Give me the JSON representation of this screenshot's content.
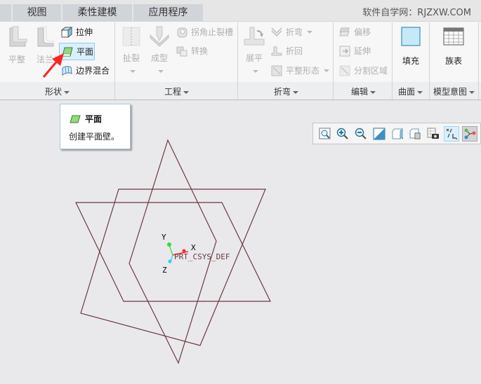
{
  "tabs": [
    {
      "label": ""
    },
    {
      "label": "视图"
    },
    {
      "label": "柔性建模"
    },
    {
      "label": "应用程序"
    }
  ],
  "watermark": "软件自学网：RJZXW.COM",
  "ribbon": {
    "shape": {
      "group_label": "形状",
      "flat": "平整",
      "flange": "法兰",
      "extrude": "拉伸",
      "planar": "平面",
      "boundary_blend": "边界混合"
    },
    "engineering": {
      "group_label": "工程",
      "rip": "扯裂",
      "form": "成型",
      "corner_relief": "拐角止裂槽",
      "convert": "转换"
    },
    "bend": {
      "group_label": "折弯",
      "unbend": "展平",
      "bend": "折弯",
      "bend_back": "折回",
      "flat_state": "平整形态"
    },
    "edit": {
      "group_label": "编辑",
      "offset": "偏移",
      "extend": "延伸",
      "split_area": "分割区域"
    },
    "surface": {
      "group_label": "曲面",
      "fill": "填充"
    },
    "model_intent": {
      "group_label": "模型意图",
      "family_table": "族表"
    }
  },
  "tooltip": {
    "title": "平面",
    "description": "创建平面壁。"
  },
  "view_toolbar": {
    "items": [
      "refit-icon",
      "zoom-in-icon",
      "zoom-out-icon",
      "repaint-icon",
      "display-style-icon",
      "saved-orientations-icon",
      "view-manager-icon",
      "datum-display-icon",
      "annotation-display-icon"
    ]
  },
  "model": {
    "csys_label": "PRT_CSYS_DEF",
    "axis_x": "X",
    "axis_y": "Y",
    "axis_z": "Z",
    "edge_color": "#6b3a3e",
    "axis_colors": {
      "x": "#ff2a2a",
      "y": "#33dd33",
      "z": "#33ccee"
    }
  },
  "colors": {
    "accent": "#8fcdf0",
    "selected_bg": "#d9effc",
    "arrow": "#ff2222"
  }
}
